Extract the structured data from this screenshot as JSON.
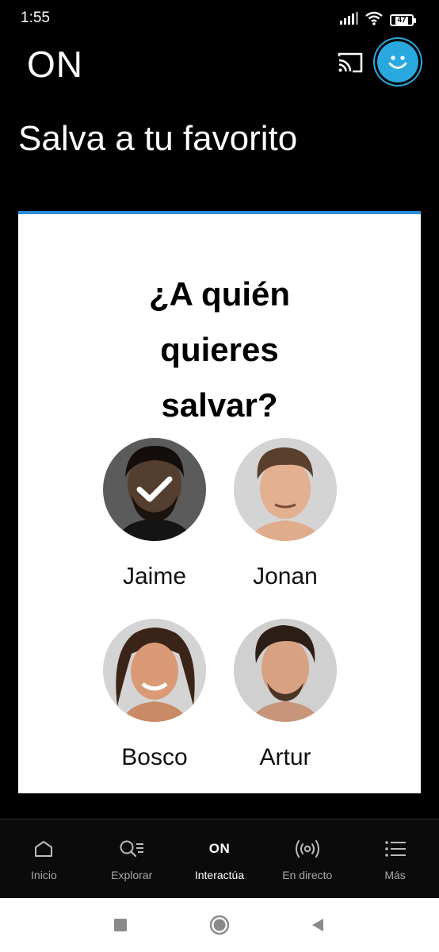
{
  "status_bar": {
    "time": "1:55",
    "battery": "47"
  },
  "header": {
    "logo": "ON",
    "accent_color": "#29a8e0"
  },
  "page": {
    "title": "Salva a tu favorito"
  },
  "card": {
    "accent_color": "#2f8bd6",
    "question_lines": [
      "¿A quién",
      "quieres",
      "salvar?"
    ],
    "candidates": [
      {
        "name": "Jaime",
        "selected": true
      },
      {
        "name": "Jonan",
        "selected": false
      },
      {
        "name": "Bosco",
        "selected": false
      },
      {
        "name": "Artur",
        "selected": false
      }
    ]
  },
  "bottom_nav": {
    "items": [
      {
        "label": "Inicio",
        "icon": "home-icon"
      },
      {
        "label": "Explorar",
        "icon": "explore-icon"
      },
      {
        "label": "Interactúa",
        "icon": "on-logo-icon",
        "icon_text": "ON",
        "active": true
      },
      {
        "label": "En directo",
        "icon": "live-broadcast-icon"
      },
      {
        "label": "Más",
        "icon": "menu-list-icon"
      }
    ]
  },
  "system_nav": {
    "icons": [
      "recents-icon",
      "home-circle-icon",
      "back-icon"
    ]
  }
}
